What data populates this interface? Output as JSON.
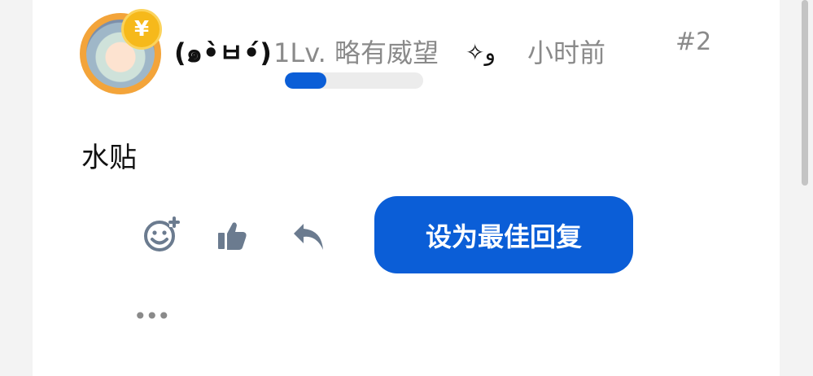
{
  "post": {
    "username": "(๑•̀ㅂ•́)",
    "level_text": "1Lv. 略有威望",
    "level_progress_percent": 30,
    "sparkle_text": "✧و",
    "time_ago": "小时前",
    "floor": "#2",
    "content": "水贴"
  },
  "actions": {
    "best_reply_label": "设为最佳回复",
    "more_label": "•••"
  },
  "coin_symbol": "¥",
  "colors": {
    "accent": "#0b5ed7",
    "coin": "#f6b91b",
    "avatar_ring": "#f3a43a",
    "muted_text": "#8a8a8a",
    "icon_gray": "#6b7b8f"
  },
  "icons": [
    "add-emoji-icon",
    "thumbs-up-icon",
    "reply-icon",
    "more-icon",
    "coin-icon"
  ]
}
